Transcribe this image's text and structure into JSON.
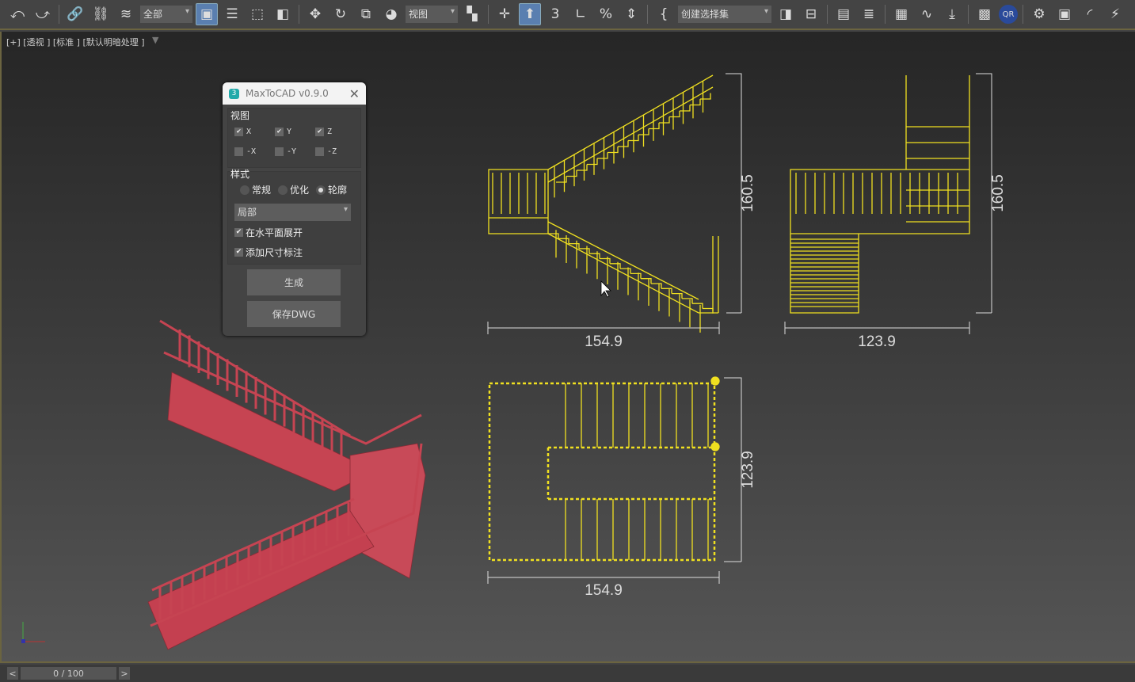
{
  "toolbar": {
    "icons_a": [
      "undo-icon:⤺",
      "redo-icon:⤻",
      "|",
      "link-icon:🔗",
      "unlink-icon:⛓",
      "bind-spacewarp-icon:≋"
    ],
    "filter_dropdown": "全部",
    "icons_b": [
      "select-object-icon:▣",
      "select-by-name-icon:☰",
      "rect-selection-icon:⬚",
      "window-crossing-icon:◧",
      "|",
      "move-icon:✥",
      "rotate-icon:↻",
      "scale-icon:⧉",
      "placement-icon:◕"
    ],
    "coord_dropdown": "视图",
    "icons_c": [
      "pivot-icon:▚",
      "|",
      "snap-toggle-icon:✛",
      "keyboard-shortcut-icon:⬆",
      "snap-3d-icon:3",
      "angle-snap-icon:∟",
      "percent-snap-icon:%",
      "spinner-snap-icon:⇕",
      "|",
      "edit-named-sel-icon:{"
    ],
    "selection_set_dropdown": "创建选择集",
    "icons_d": [
      "mirror-icon:◨",
      "align-icon:⊟",
      "|",
      "layer-explorer-icon:▤",
      "layers-icon:≣",
      "|",
      "schematic-icon:▦",
      "curve-editor-icon:∿",
      "dope-sheet-icon:⤓",
      "|",
      "material-editor-icon:▩",
      "qr-icon:QR",
      "|",
      "render-setup-icon:⚙",
      "rendered-frame-icon:▣",
      "render-icon:◜",
      "render-production-icon:⚡"
    ]
  },
  "viewport": {
    "label": "[+] [透视 ] [标准 ] [默认明暗处理 ]",
    "filter_icon": "▼"
  },
  "dialog": {
    "title": "MaxToCAD v0.9.0",
    "close": "✕",
    "logo": "3",
    "views_label": "视图",
    "views": [
      {
        "label": "X",
        "checked": true
      },
      {
        "label": "Y",
        "checked": true
      },
      {
        "label": "Z",
        "checked": true
      },
      {
        "label": "-X",
        "checked": false
      },
      {
        "label": "-Y",
        "checked": false
      },
      {
        "label": "-Z",
        "checked": false
      }
    ],
    "style_label": "样式",
    "styles": [
      {
        "label": "常规",
        "selected": false
      },
      {
        "label": "优化",
        "selected": false
      },
      {
        "label": "轮廓",
        "selected": true
      }
    ],
    "scope_dropdown": "局部",
    "expand_horizontal": {
      "label": "在水平面展开",
      "checked": true
    },
    "add_dimensions": {
      "label": "添加尺寸标注",
      "checked": true
    },
    "generate_button": "生成",
    "save_button": "保存DWG"
  },
  "drawings": {
    "front": {
      "width": "154.9",
      "height": "160.5"
    },
    "side": {
      "width": "123.9",
      "height": "160.5"
    },
    "top": {
      "width": "154.9",
      "height": "123.9"
    }
  },
  "colors": {
    "cad": "#f0e020",
    "model": "#c8404f"
  },
  "timeline": {
    "prev": "<",
    "position": "0 / 100",
    "next": ">"
  }
}
